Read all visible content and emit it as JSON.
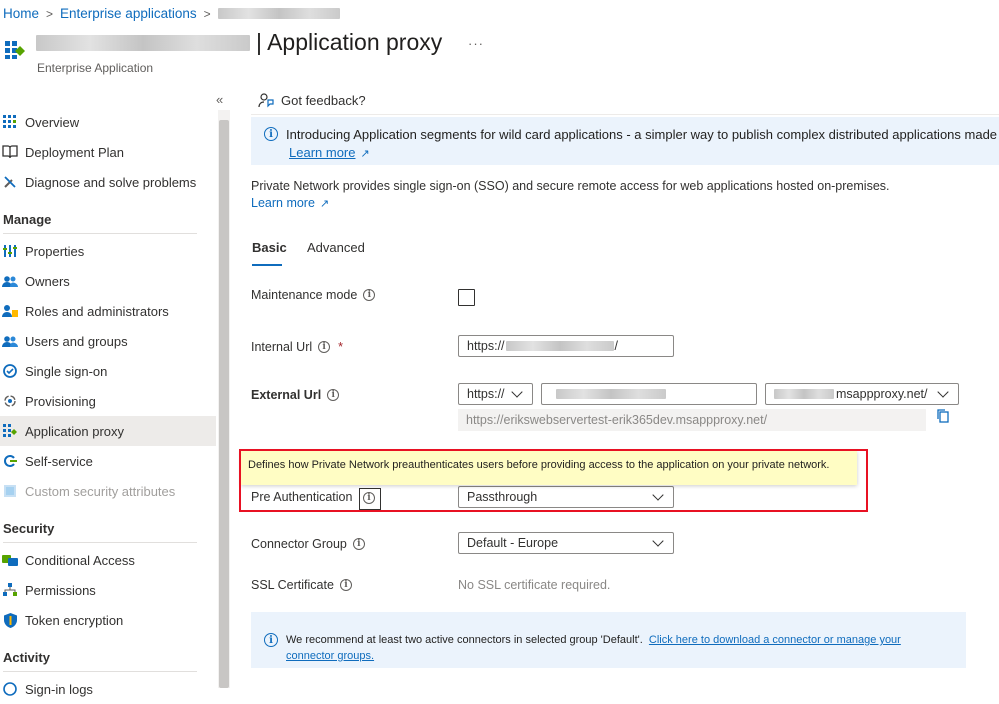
{
  "breadcrumb": {
    "home": "Home",
    "enterprise_apps": "Enterprise applications"
  },
  "header": {
    "title_suffix": "| Application proxy",
    "subtitle": "Enterprise Application",
    "more": "···"
  },
  "sidebar": {
    "collapse": "«",
    "items_top": [
      {
        "label": "Overview",
        "icon": "grid-icon"
      },
      {
        "label": "Deployment Plan",
        "icon": "book-icon"
      },
      {
        "label": "Diagnose and solve problems",
        "icon": "wrench-icon"
      }
    ],
    "sections": [
      {
        "heading": "Manage",
        "items": [
          {
            "label": "Properties",
            "icon": "properties-icon"
          },
          {
            "label": "Owners",
            "icon": "users-icon"
          },
          {
            "label": "Roles and administrators",
            "icon": "roles-icon"
          },
          {
            "label": "Users and groups",
            "icon": "users-icon"
          },
          {
            "label": "Single sign-on",
            "icon": "sso-icon"
          },
          {
            "label": "Provisioning",
            "icon": "provisioning-icon"
          },
          {
            "label": "Application proxy",
            "icon": "app-proxy-icon"
          },
          {
            "label": "Self-service",
            "icon": "self-service-icon"
          },
          {
            "label": "Custom security attributes",
            "icon": "attributes-icon"
          }
        ]
      },
      {
        "heading": "Security",
        "items": [
          {
            "label": "Conditional Access",
            "icon": "conditional-access-icon"
          },
          {
            "label": "Permissions",
            "icon": "permissions-icon"
          },
          {
            "label": "Token encryption",
            "icon": "shield-icon"
          }
        ]
      },
      {
        "heading": "Activity",
        "items": [
          {
            "label": "Sign-in logs",
            "icon": "log-icon"
          }
        ]
      }
    ]
  },
  "feedback": {
    "label": "Got feedback?"
  },
  "info_banner": {
    "text": "Introducing Application segments for wild card applications - a simpler way to publish complex distributed applications made up of m",
    "link": "Learn more"
  },
  "description": {
    "text": "Private Network provides single sign-on (SSO) and secure remote access for web applications hosted on-premises.",
    "link": "Learn more"
  },
  "tabs": [
    {
      "label": "Basic",
      "active": true
    },
    {
      "label": "Advanced",
      "active": false
    }
  ],
  "form": {
    "maintenance_mode": {
      "label": "Maintenance mode",
      "checked": false
    },
    "internal_url": {
      "label": "Internal Url",
      "required": "*",
      "prefix": "https://",
      "suffix": "/"
    },
    "external_url": {
      "label": "External Url",
      "scheme": "https://",
      "domain_suffix": "msappproxy.net/",
      "full_url": "https://erikswebservertest-erik365dev.msappproxy.net/"
    },
    "pre_authentication": {
      "label": "Pre Authentication",
      "value": "Passthrough",
      "tooltip": "Defines how Private Network preauthenticates users before providing access to the application on your private network."
    },
    "connector_group": {
      "label": "Connector Group",
      "value": "Default - Europe"
    },
    "ssl_certificate": {
      "label": "SSL Certificate",
      "value": "No SSL certificate required."
    }
  },
  "bottom_banner": {
    "text": "We recommend at least two active connectors in selected group 'Default'.",
    "link": "Click here to download a connector or manage your connector groups."
  },
  "colors": {
    "accent": "#0f6cbd",
    "highlight": "#e81123",
    "banner_bg": "#ebf3fc",
    "tooltip_bg": "#fffdc4"
  }
}
